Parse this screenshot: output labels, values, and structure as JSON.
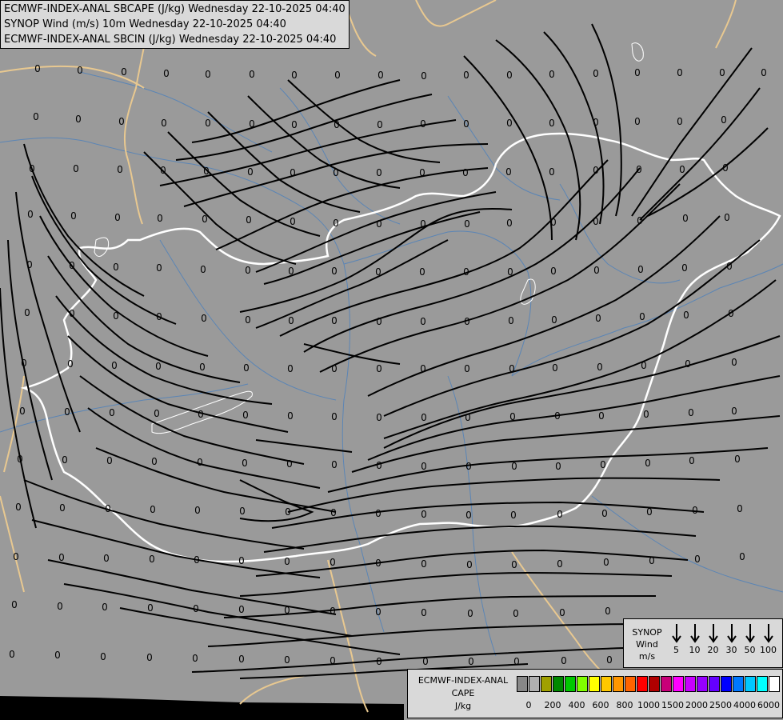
{
  "header": {
    "line1": "ECMWF-INDEX-ANAL SBCAPE (J/kg) Wednesday 22-10-2025 04:40",
    "line2": "SYNOP Wind (m/s) 10m Wednesday 22-10-2025 04:40",
    "line3": "ECMWF-INDEX-ANAL SBCIN (J/kg) Wednesday 22-10-2025 04:40"
  },
  "map": {
    "background_color": "#9a9a9a",
    "border_color_hungary": "#ffffff",
    "border_color_other": "#e8c890",
    "river_color": "#5b85b5",
    "streamline_color": "#000000",
    "cape_value_label": "0"
  },
  "synop_legend": {
    "title_line1": "SYNOP",
    "title_line2": "Wind",
    "title_line3": "m/s",
    "values": [
      "5",
      "10",
      "20",
      "30",
      "50",
      "100"
    ]
  },
  "cape_legend": {
    "title_line1": "ECMWF-INDEX-ANAL",
    "title_line2": "CAPE",
    "title_line3": "J/kg",
    "colors": [
      "#888888",
      "#b0b0b0",
      "#a0a000",
      "#008800",
      "#00c800",
      "#80ff00",
      "#ffff00",
      "#ffc800",
      "#ff9600",
      "#ff6400",
      "#ff0000",
      "#b00000",
      "#c80078",
      "#ff00ff",
      "#c800ff",
      "#9600ff",
      "#6400ff",
      "#0000ff",
      "#0078ff",
      "#00c8ff",
      "#00ffff",
      "#ffffff"
    ],
    "labels": [
      "0",
      "200",
      "400",
      "600",
      "800",
      "1000",
      "1500",
      "2000",
      "2500",
      "4000",
      "6000"
    ]
  }
}
